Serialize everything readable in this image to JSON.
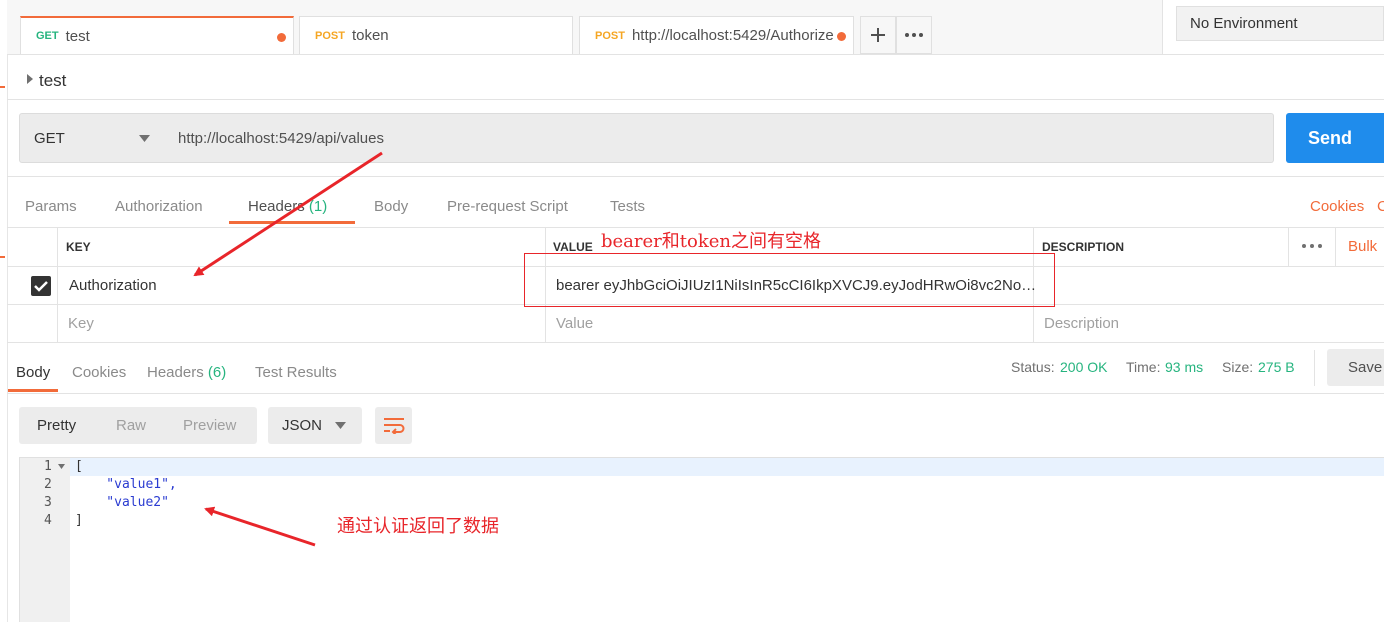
{
  "tabs": [
    {
      "method": "GET",
      "name": "test",
      "method_color": "#26b47f"
    },
    {
      "method": "POST",
      "name": "token",
      "method_color": "#f5a623"
    },
    {
      "method": "POST",
      "name": "http://localhost:5429/Authorize",
      "method_color": "#f5a623"
    }
  ],
  "environment": "No Environment",
  "request_name": "test",
  "request": {
    "method": "GET",
    "url": "http://localhost:5429/api/values",
    "send_label": "Send"
  },
  "request_tabs": {
    "params": "Params",
    "authorization": "Authorization",
    "headers": "Headers",
    "headers_count": "(1)",
    "body": "Body",
    "prerequest": "Pre-request Script",
    "tests": "Tests",
    "cookies": "Cookies",
    "cookies_trunc": "C"
  },
  "headers_table": {
    "col_key": "KEY",
    "col_value": "VALUE",
    "col_desc": "DESCRIPTION",
    "bulk": "Bulk",
    "row": {
      "key": "Authorization",
      "value": "bearer eyJhbGciOiJIUzI1NiIsInR5cCI6IkpXVCJ9.eyJodHRwOi8vc2No…",
      "checked": true
    },
    "placeholder": {
      "key": "Key",
      "value": "Value",
      "description": "Description"
    }
  },
  "response_tabs": {
    "body": "Body",
    "cookies": "Cookies",
    "headers": "Headers",
    "headers_count": "(6)",
    "test_results": "Test Results"
  },
  "status": {
    "status_label": "Status:",
    "status_value": "200 OK",
    "time_label": "Time:",
    "time_value": "93 ms",
    "size_label": "Size:",
    "size_value": "275 B",
    "save": "Save"
  },
  "view": {
    "pretty": "Pretty",
    "raw": "Raw",
    "preview": "Preview",
    "format": "JSON"
  },
  "code_lines": [
    {
      "num": "1",
      "text": "["
    },
    {
      "num": "2",
      "text": "    \"value1\","
    },
    {
      "num": "3",
      "text": "    \"value2\""
    },
    {
      "num": "4",
      "text": "]"
    }
  ],
  "annotations": {
    "header_note": "bearer和token之间有空格",
    "result_note": "通过认证返回了数据"
  },
  "colors": {
    "accent": "#f26b3a",
    "send": "#1f8cec",
    "green": "#26b47f",
    "annotation": "#e8252a"
  }
}
